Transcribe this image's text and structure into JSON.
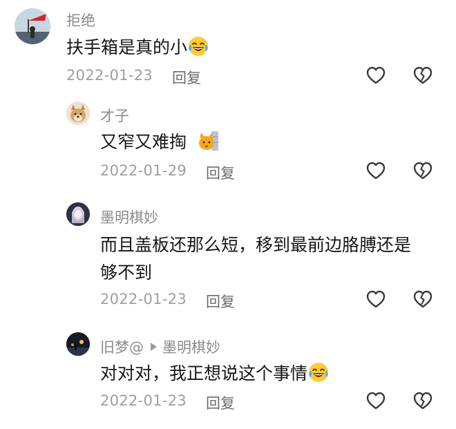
{
  "comments": [
    {
      "username": "拒绝",
      "text": "扶手箱是真的小",
      "date": "2022-01-23",
      "reply_label": "回复"
    },
    {
      "username": "才子",
      "text": "又窄又难掏",
      "date": "2022-01-29",
      "reply_label": "回复"
    },
    {
      "username": "墨明棋妙",
      "text_line1": "而且盖板还那么短，移到最前边胳膊还是",
      "text_line2": "够不到",
      "date": "2022-01-23",
      "reply_label": "回复"
    },
    {
      "username": "旧梦@",
      "reply_to": "墨明棋妙",
      "text": "对对对，我正想说这个事情",
      "date": "2022-01-23",
      "reply_label": "回复"
    }
  ],
  "icons": {
    "like": "heart-outline-icon",
    "dislike": "broken-heart-icon",
    "emoji_laugh": "tears-of-joy-emoji",
    "emoji_cat": "cat-emoji"
  },
  "colors": {
    "text": "#161616",
    "username": "#8a8a8a",
    "meta": "#9e9e9e",
    "icon": "#3a3a3a"
  }
}
